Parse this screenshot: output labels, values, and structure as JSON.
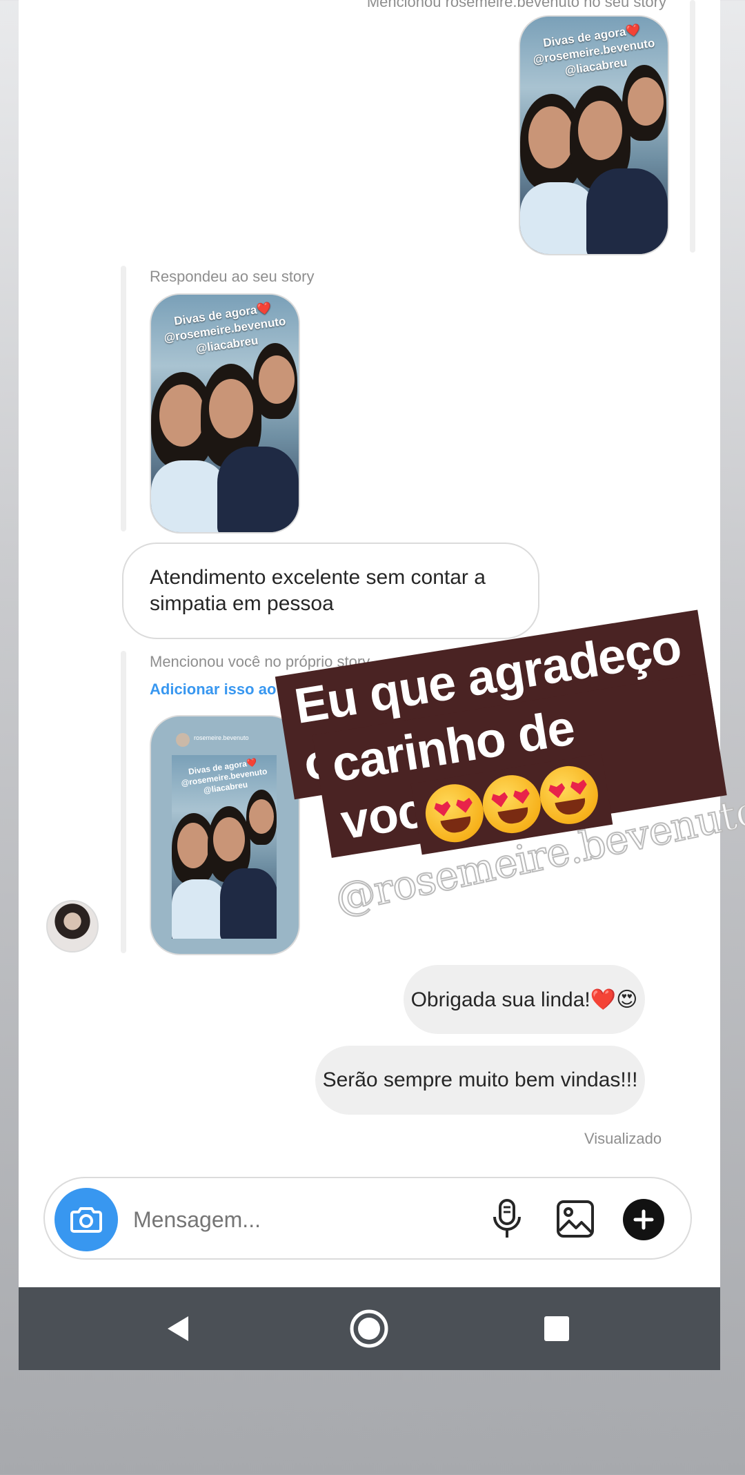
{
  "chat": {
    "top_caption": "Mencionou rosemeire.bevenuto no seu story",
    "story_caption": "Divas de agora❤️\n@rosemeire.bevenuto\n@liacabreu",
    "reply_caption": "Respondeu ao seu story",
    "message_in_1": "Atendimento excelente sem contar a simpatia em pessoa",
    "mention_caption": "Mencionou você no próprio story",
    "add_to_story_link": "Adicionar isso ao seu story",
    "mini_story_header": "rosemeire.bevenuto",
    "message_out_1": "Obrigada sua linda!❤️😍",
    "message_out_2": "Serão sempre muito bem vindas!!!",
    "seen_status": "Visualizado"
  },
  "composer": {
    "placeholder": "Mensagem..."
  },
  "overlay": {
    "line1": "Eu que agradeço o",
    "line2": "carinho de vocês",
    "watermark": "@rosemeire.bevenuto"
  },
  "icons": {
    "camera": "camera-icon",
    "mic": "microphone-icon",
    "gallery": "gallery-icon",
    "plus": "plus-circle-icon",
    "back": "back-triangle-icon",
    "home": "home-circle-icon",
    "recents": "recents-square-icon"
  },
  "colors": {
    "accent_blue": "#3897f0",
    "link_blue": "#3897f0",
    "overlay_bg": "#4a2323",
    "navbar": "#4b5056"
  }
}
